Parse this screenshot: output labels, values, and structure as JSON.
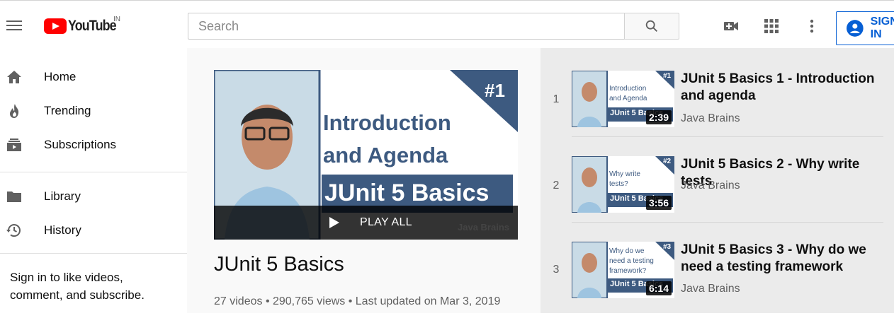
{
  "header": {
    "logo_text": "YouTube",
    "country": "IN",
    "search_placeholder": "Search",
    "signin_label": "SIGN IN"
  },
  "sidebar": {
    "items": [
      {
        "label": "Home",
        "icon": "home-icon"
      },
      {
        "label": "Trending",
        "icon": "trending-icon"
      },
      {
        "label": "Subscriptions",
        "icon": "subscriptions-icon"
      },
      {
        "label": "Library",
        "icon": "library-icon"
      },
      {
        "label": "History",
        "icon": "history-icon"
      }
    ],
    "signin_prompt": "Sign in to like videos, comment, and subscribe."
  },
  "playlist": {
    "hero": {
      "badge": "#1",
      "line1": "Introduction",
      "line2": "and Agenda",
      "banner": "JUnit 5 Basics",
      "brand": "Java Brains"
    },
    "play_all_label": "PLAY ALL",
    "title": "JUnit 5 Basics",
    "meta": "27 videos • 290,765 views • Last updated on Mar 3, 2019"
  },
  "videos": [
    {
      "index": "1",
      "title": "JUnit 5 Basics 1 - Introduction and agenda",
      "channel": "Java Brains",
      "duration": "2:39",
      "thumb_badge": "#1",
      "thumb_line1": "Introduction",
      "thumb_line2": "and Agenda",
      "thumb_line3": "",
      "thumb_banner": "JUnit 5 Basics"
    },
    {
      "index": "2",
      "title": "JUnit 5 Basics 2 - Why write tests",
      "channel": "Java Brains",
      "duration": "3:56",
      "thumb_badge": "#2",
      "thumb_line1": "Why write",
      "thumb_line2": "tests?",
      "thumb_line3": "",
      "thumb_banner": "JUnit 5 Basics"
    },
    {
      "index": "3",
      "title": "JUnit 5 Basics 3 - Why do we need a testing framework",
      "channel": "Java Brains",
      "duration": "6:14",
      "thumb_badge": "#3",
      "thumb_line1": "Why do we",
      "thumb_line2": "need a testing",
      "thumb_line3": "framework?",
      "thumb_banner": "JUnit 5 Basics"
    }
  ],
  "colors": {
    "accent": "#065fd4",
    "brand_red": "#ff0000",
    "thumb_navy": "#3d5a80"
  }
}
